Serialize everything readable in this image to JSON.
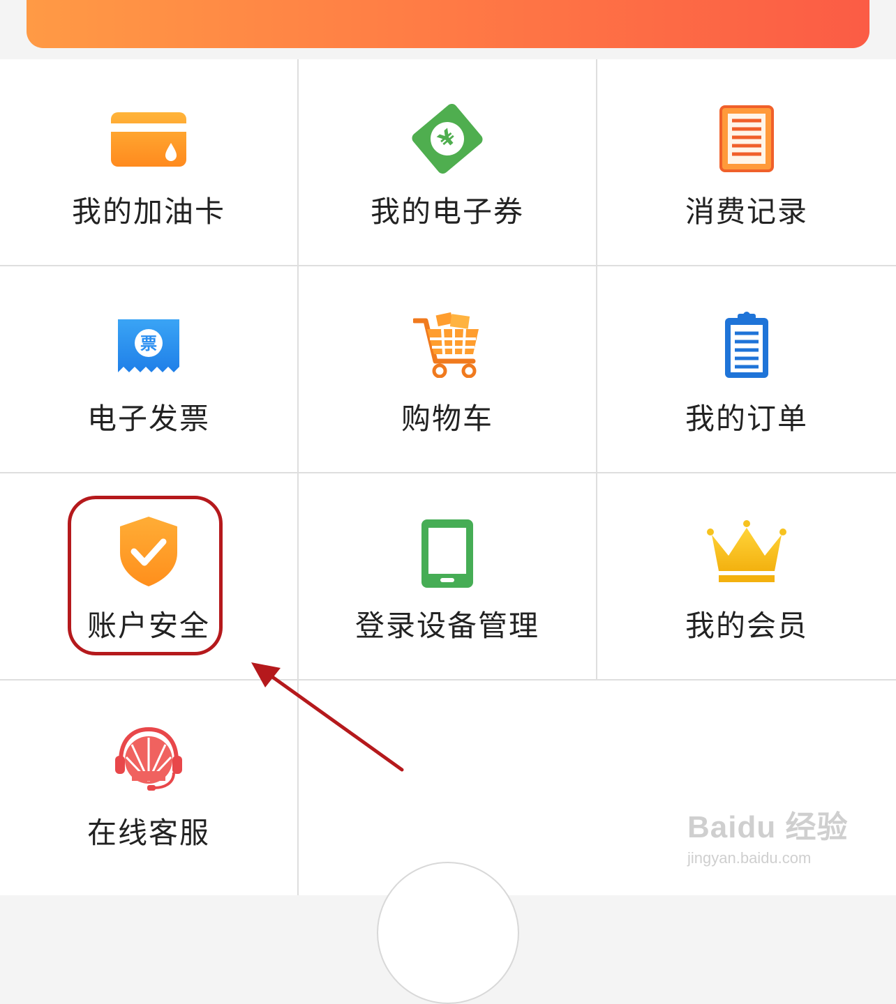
{
  "menu": {
    "items": [
      {
        "label": "我的加油卡",
        "icon": "fuel-card-icon"
      },
      {
        "label": "我的电子券",
        "icon": "e-coupon-icon"
      },
      {
        "label": "消费记录",
        "icon": "records-icon"
      },
      {
        "label": "电子发票",
        "icon": "invoice-icon"
      },
      {
        "label": "购物车",
        "icon": "shopping-cart-icon"
      },
      {
        "label": "我的订单",
        "icon": "orders-clipboard-icon"
      },
      {
        "label": "账户安全",
        "icon": "shield-check-icon"
      },
      {
        "label": "登录设备管理",
        "icon": "tablet-device-icon"
      },
      {
        "label": "我的会员",
        "icon": "crown-icon"
      },
      {
        "label": "在线客服",
        "icon": "customer-service-icon"
      }
    ]
  },
  "icon_glyphs": {
    "coupon": "¥",
    "invoice": "票"
  },
  "watermark": {
    "logo": "Baidu 经验",
    "url": "jingyan.baidu.com"
  },
  "colors": {
    "banner_start": "#ff9a45",
    "banner_end": "#fb5c45",
    "annotation": "#b5191c"
  }
}
